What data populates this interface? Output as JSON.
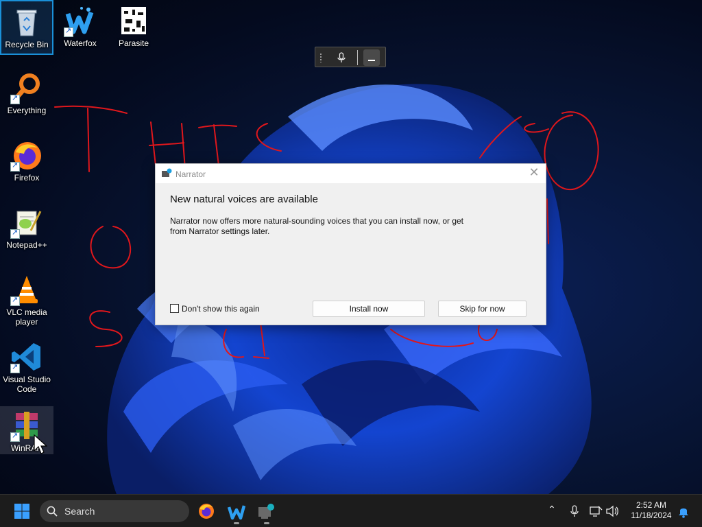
{
  "desktop": {
    "icons": [
      {
        "label": "Recycle Bin",
        "icon": "recycle-bin-icon"
      },
      {
        "label": "Waterfox",
        "icon": "waterfox-icon"
      },
      {
        "label": "Parasite",
        "icon": "parasite-icon"
      },
      {
        "label": "Everything",
        "icon": "everything-search-icon"
      },
      {
        "label": "Firefox",
        "icon": "firefox-icon"
      },
      {
        "label": "Notepad++",
        "icon": "notepadpp-icon"
      },
      {
        "label": "VLC media player",
        "icon": "vlc-icon"
      },
      {
        "label": "Visual Studio Code",
        "icon": "vscode-icon"
      },
      {
        "label": "WinRAR",
        "icon": "winrar-icon"
      }
    ]
  },
  "voice_bar": {
    "mic_icon": "microphone-icon",
    "minimize_icon": "minimize-icon"
  },
  "dialog": {
    "title": "Narrator",
    "close_icon": "close-icon",
    "heading": "New natural voices are available",
    "body": "Narrator now offers more natural-sounding voices that you can install now, or get from Narrator settings later.",
    "checkbox_label": "Don't show this again",
    "checkbox_checked": false,
    "install_label": "Install now",
    "skip_label": "Skip for now"
  },
  "taskbar": {
    "search_placeholder": "Search",
    "pinned": [
      "firefox-icon",
      "waterfox-icon",
      "narrator-icon"
    ],
    "tray_icons": [
      "chevron-up-icon",
      "microphone-icon",
      "network-icon",
      "volume-icon"
    ],
    "time": "2:52 AM",
    "date": "11/18/2024",
    "notification_icon": "bell-icon"
  },
  "colors": {
    "accent": "#1a90d8",
    "taskbar": "#1c1c1c",
    "ink": "#e0171c"
  }
}
